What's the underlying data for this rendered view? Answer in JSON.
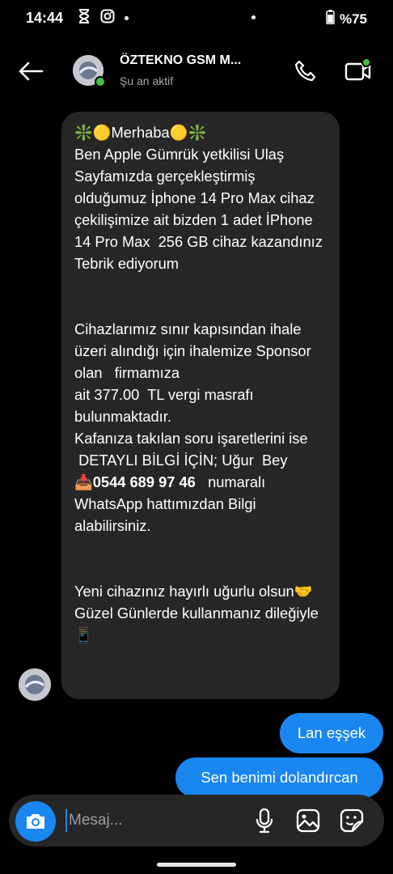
{
  "status_bar": {
    "time": "14:44",
    "battery_percent": "%75",
    "icons": [
      "hourglass-icon",
      "instagram-icon",
      "dot-icon",
      "battery-icon"
    ]
  },
  "header": {
    "contact_name": "ÖZTEKNO GSM M...",
    "contact_status": "Şu an aktif",
    "icons": [
      "back-arrow-icon",
      "phone-icon",
      "video-camera-icon"
    ]
  },
  "conversation": {
    "incoming_message": {
      "line_1": "❇️🟡Merhaba🟡❇️",
      "body_1": "Ben Apple Gümrük yetkilisi Ulaş Sayfamızda gerçekleştirmiş olduğumuz İphone 14 Pro Max cihaz çekilişimize ait bizden 1 adet İPhone 14 Pro Max  256 GB cihaz kazandınız Tebrik ediyorum\n\n\nCihazlarımız sınır kapısından ihale üzeri alındığı için ihalemize Sponsor olan   firmamıza\nait 377.00  TL vergi masrafı bulunmaktadır.\nKafanıza takılan soru işaretlerini ise\n DETAYLI BİLGİ İÇİN; Uğur  Bey\n",
      "phone_prefix": "📥",
      "phone_number": "0544 689 97 46",
      "body_2": "   numaralı WhatsApp hattımızdan Bilgi alabilirsiniz.\n\n\nYeni cihazınız hayırlı uğurlu olsun🤝 Güzel Günlerde kullanmanız dileğiyle 📱"
    },
    "outgoing_messages": [
      "Lan eşşek",
      "Sen benimi dolandırcan"
    ]
  },
  "composer": {
    "placeholder": "Mesaj...",
    "icons": [
      "camera-icon",
      "microphone-icon",
      "gallery-icon",
      "sticker-icon"
    ]
  },
  "colors": {
    "background": "#000000",
    "incoming_bubble": "#262626",
    "outgoing_bubble": "#1a86f0",
    "online": "#3ec43e",
    "secondary_text": "#a8a8a8"
  }
}
